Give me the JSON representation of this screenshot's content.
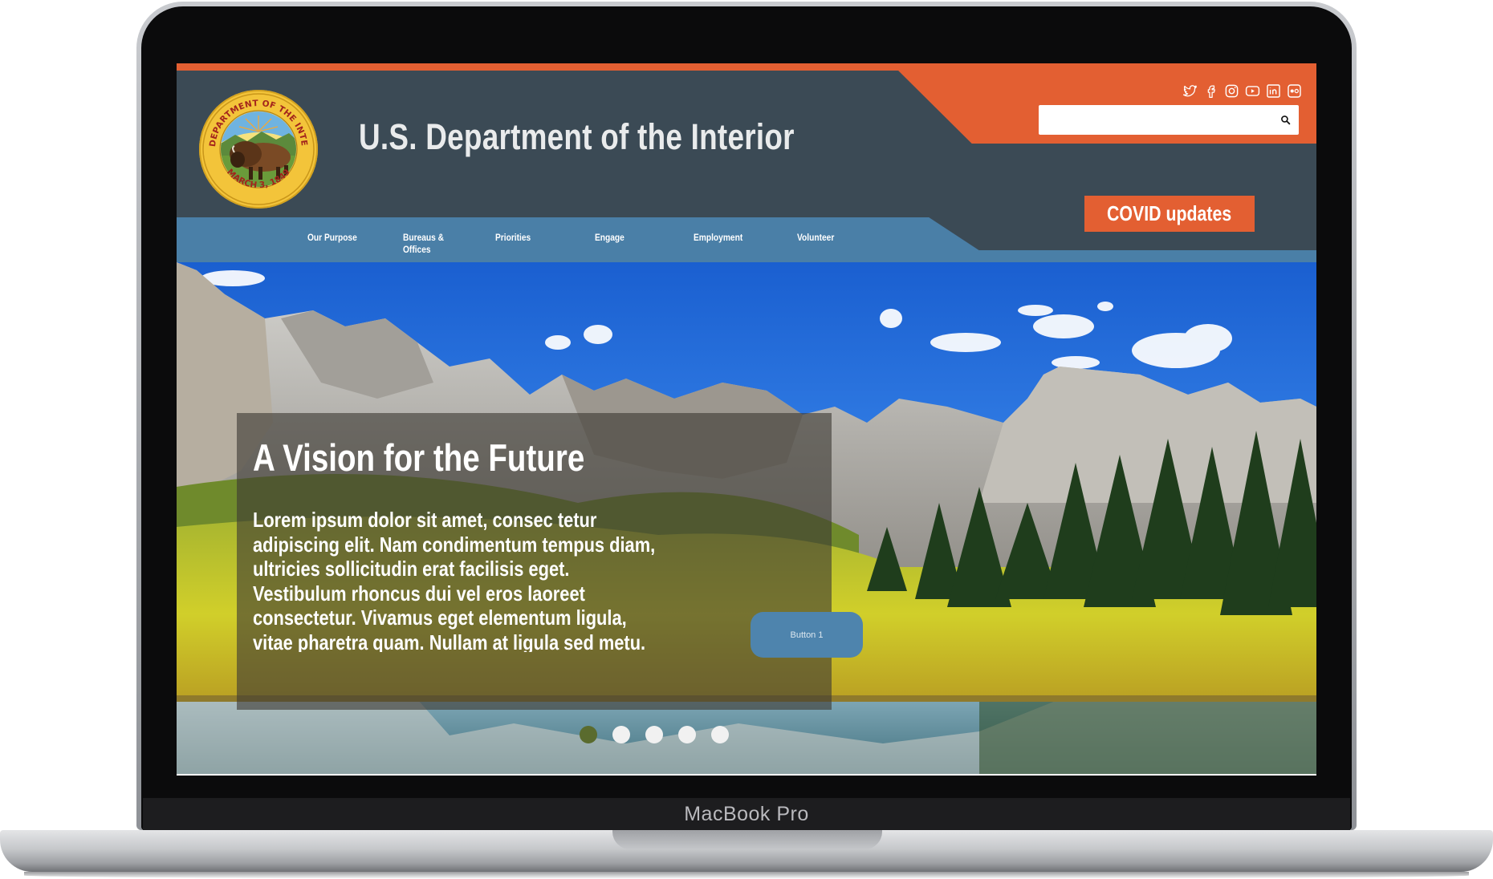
{
  "device": {
    "model_label": "MacBook Pro"
  },
  "header": {
    "site_title": "U.S. Department of the Interior",
    "logo_alt": "U.S. Department of the Interior seal",
    "seal_text_top": "U.S. DEPARTMENT OF THE INTERIOR",
    "seal_text_bottom": "MARCH 3, 1849",
    "social": [
      "twitter-icon",
      "facebook-icon",
      "instagram-icon",
      "youtube-icon",
      "linkedin-icon",
      "flickr-icon"
    ],
    "search": {
      "placeholder": "",
      "value": ""
    },
    "covid_button": "COVID updates"
  },
  "nav": {
    "items": [
      {
        "label": "Our Purpose"
      },
      {
        "label": "Bureaus & Offices"
      },
      {
        "label": "Priorities"
      },
      {
        "label": "Engage"
      },
      {
        "label": "Employment"
      },
      {
        "label": "Volunteer"
      }
    ]
  },
  "hero": {
    "title": "A Vision for the Future",
    "body": "Lorem ipsum dolor sit amet, consec tetur adipiscing elit. Nam condimentum tempus diam, ultricies sollicitudin erat facilisis eget. Vestibulum rhoncus dui vel eros laoreet consectetur. Vivamus eget elementum ligula, vitae pharetra quam. Nullam at ligula sed metu.",
    "button": "Button 1",
    "carousel": {
      "slides": 5,
      "active": 1
    }
  },
  "colors": {
    "header_bg": "#3b4a55",
    "accent_orange": "#e35f32",
    "nav_blue": "#4a7fa7",
    "carousel_active": "#5a6b2e"
  }
}
